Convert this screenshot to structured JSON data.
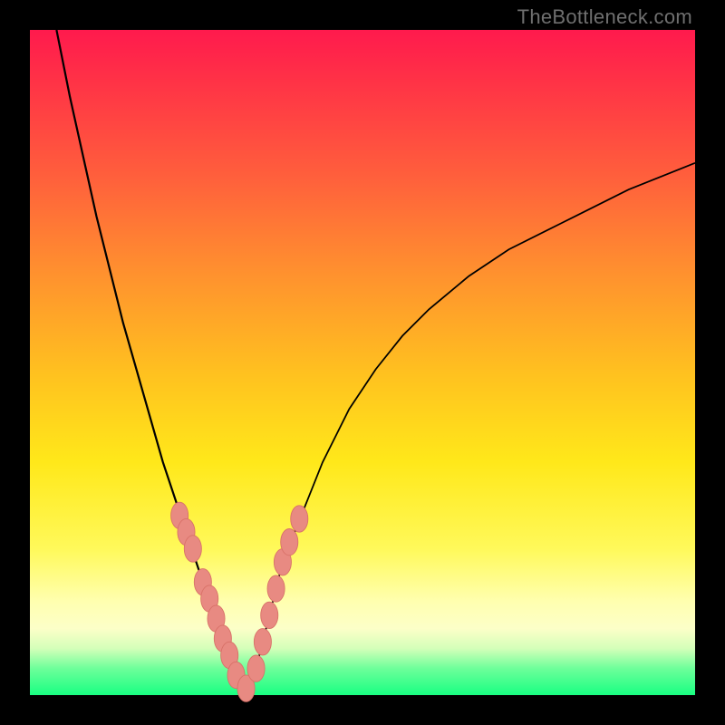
{
  "watermark": "TheBottleneck.com",
  "colors": {
    "frame": "#000000",
    "curve": "#000000",
    "marker_fill": "#e88a82",
    "marker_stroke": "#d87168"
  },
  "chart_data": {
    "type": "line",
    "title": "",
    "xlabel": "",
    "ylabel": "",
    "xlim": [
      0,
      100
    ],
    "ylim": [
      0,
      100
    ],
    "grid": false,
    "legend": false,
    "series": [
      {
        "name": "left-branch",
        "x": [
          4,
          6,
          8,
          10,
          12,
          14,
          16,
          18,
          20,
          22,
          23,
          24,
          25,
          26,
          27,
          28,
          29,
          30,
          32
        ],
        "values": [
          100,
          90,
          81,
          72,
          64,
          56,
          49,
          42,
          35,
          29,
          26,
          23,
          20,
          17,
          15,
          12,
          9,
          6,
          0.5
        ]
      },
      {
        "name": "right-branch",
        "x": [
          32,
          34,
          35,
          36,
          37,
          38,
          40,
          42,
          44,
          46,
          48,
          52,
          56,
          60,
          66,
          72,
          80,
          90,
          100
        ],
        "values": [
          0.5,
          4,
          8,
          12,
          16,
          20,
          25,
          30,
          35,
          39,
          43,
          49,
          54,
          58,
          63,
          67,
          71,
          76,
          80
        ]
      }
    ],
    "markers": {
      "name": "highlight-points",
      "x": [
        22.5,
        23.5,
        24.5,
        26.0,
        27.0,
        28.0,
        29.0,
        30.0,
        31.0,
        32.5,
        34.0,
        35.0,
        36.0,
        37.0,
        38.0,
        39.0,
        40.5
      ],
      "values": [
        27.0,
        24.5,
        22.0,
        17.0,
        14.5,
        11.5,
        8.5,
        6.0,
        3.0,
        1.0,
        4.0,
        8.0,
        12.0,
        16.0,
        20.0,
        23.0,
        26.5
      ],
      "rx": 1.3,
      "ry": 2.0
    }
  }
}
